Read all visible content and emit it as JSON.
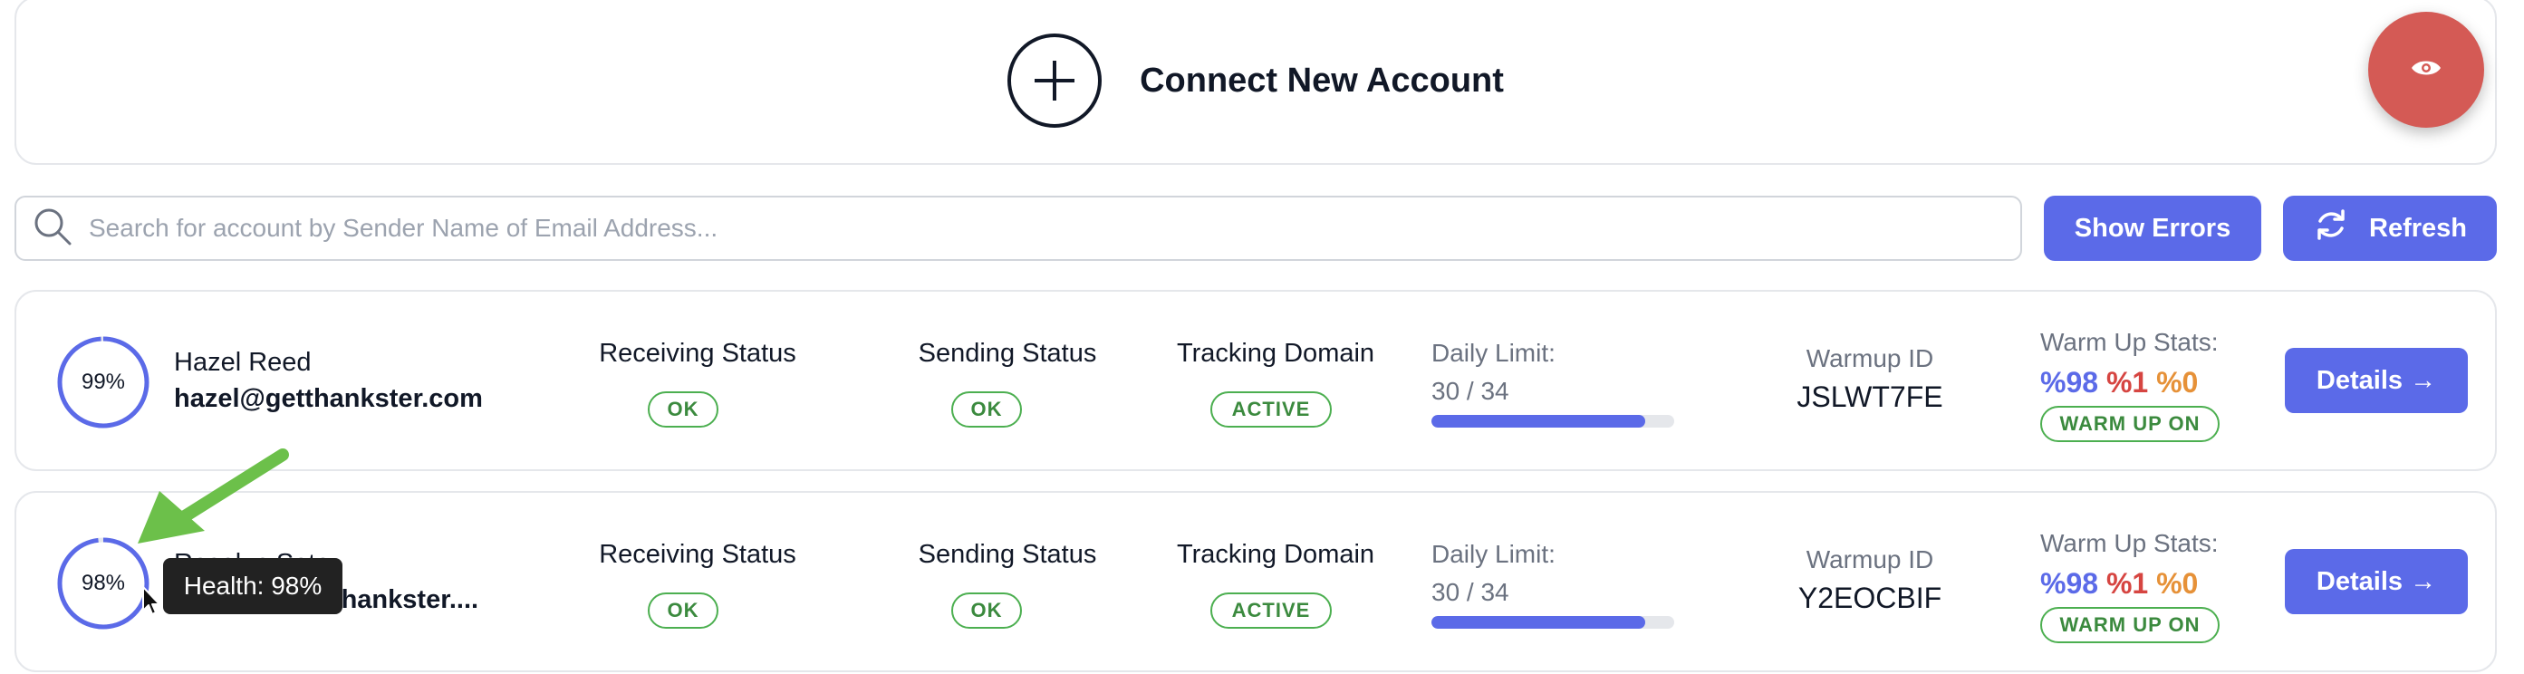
{
  "connect": {
    "label": "Connect New Account"
  },
  "search": {
    "placeholder": "Search for account by Sender Name of Email Address..."
  },
  "toolbar": {
    "show_errors_label": "Show Errors",
    "refresh_label": "Refresh"
  },
  "columns": {
    "receiving": "Receiving Status",
    "sending": "Sending Status",
    "tracking": "Tracking Domain",
    "daily_limit": "Daily Limit:",
    "warmup_id": "Warmup ID",
    "warmup_stats": "Warm Up Stats:"
  },
  "accounts": [
    {
      "health": "99%",
      "health_value": 0.99,
      "name": "Hazel Reed",
      "email": "hazel@getthankster.com",
      "receiving_status": "OK",
      "sending_status": "OK",
      "tracking_status": "ACTIVE",
      "daily_limit_text": "30 / 34",
      "daily_limit_fraction": 0.882,
      "warmup_id": "JSLWT7FE",
      "stat_inbox": "%98",
      "stat_spam": "%1",
      "stat_other": "%0",
      "warmup_badge": "WARM UP ON",
      "details_label": "Details →"
    },
    {
      "health": "98%",
      "health_value": 0.98,
      "name": "Rosalyn Soto",
      "email": "rosalyn@getthankster....",
      "receiving_status": "OK",
      "sending_status": "OK",
      "tracking_status": "ACTIVE",
      "daily_limit_text": "30 / 34",
      "daily_limit_fraction": 0.882,
      "warmup_id": "Y2EOCBIF",
      "stat_inbox": "%98",
      "stat_spam": "%1",
      "stat_other": "%0",
      "warmup_badge": "WARM UP ON",
      "details_label": "Details →"
    }
  ],
  "tooltip": {
    "text": "Health: 98%"
  },
  "colors": {
    "accent": "#5b6ae8",
    "ok_green": "#4caf50",
    "fab_red": "#d45a55",
    "arrow_green": "#6cc04a"
  },
  "icons": {
    "connect": "plus-circle-icon",
    "fab": "eye-icon",
    "search": "search-icon",
    "refresh": "refresh-icon",
    "annotation": "green-arrow-icon",
    "cursor": "mouse-cursor-icon"
  }
}
